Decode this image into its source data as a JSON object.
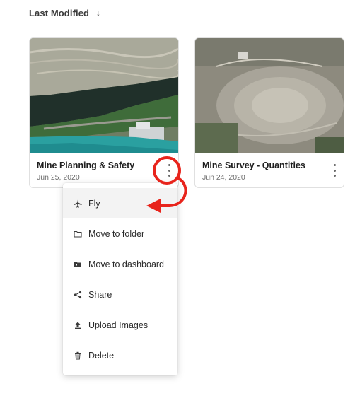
{
  "sort": {
    "label": "Last Modified",
    "arrow": "↓"
  },
  "projects": [
    {
      "title": "Mine Planning & Safety",
      "date": "Jun 25, 2020"
    },
    {
      "title": "Mine Survey - Quantities",
      "date": "Jun 24, 2020"
    }
  ],
  "menu": {
    "items": [
      {
        "label": "Fly",
        "icon": "airplane-icon"
      },
      {
        "label": "Move to folder",
        "icon": "folder-icon"
      },
      {
        "label": "Move to dashboard",
        "icon": "dashboard-folder-icon"
      },
      {
        "label": "Share",
        "icon": "share-icon"
      },
      {
        "label": "Upload Images",
        "icon": "upload-icon"
      },
      {
        "label": "Delete",
        "icon": "trash-icon"
      }
    ]
  },
  "colors": {
    "annotation": "#e8241c",
    "active_item_bg": "#f3f3f3"
  }
}
